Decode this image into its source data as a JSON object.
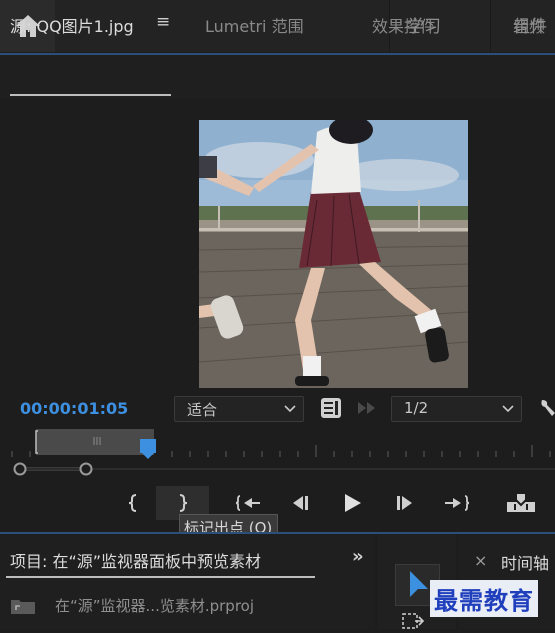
{
  "header": {
    "tabs": [
      "学习",
      "组件"
    ]
  },
  "source_panel": {
    "tabs": [
      {
        "label": "源: QQ图片1.jpg"
      },
      {
        "label": "Lumetri 范围"
      },
      {
        "label": "效果控件"
      },
      {
        "label": "音频"
      }
    ],
    "menu_glyph": "≡"
  },
  "monitor": {
    "timecode": "00:00:01:05",
    "fit": "适合",
    "resolution": "1/2"
  },
  "transport": {
    "tooltip": "标记出点 (O)"
  },
  "project_panel": {
    "title": "项目: 在“源”监视器面板中预览素材",
    "file": "在“源”监视器...览素材.prproj",
    "expand": "»"
  },
  "timeline_panel": {
    "close": "×",
    "title": "时间轴"
  },
  "watermark": "最需教育"
}
